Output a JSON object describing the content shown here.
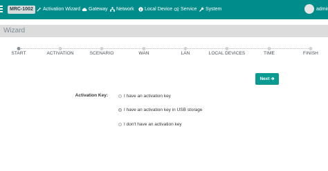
{
  "topbar": {
    "model": "MRC-1002",
    "nav": [
      {
        "label": "Activation Wizard",
        "icon": "wand-icon"
      },
      {
        "label": "Gateway",
        "icon": "cloud-icon"
      },
      {
        "label": "Network",
        "icon": "network-icon"
      },
      {
        "label": "Local Device",
        "icon": "info-icon"
      },
      {
        "label": "Service",
        "icon": "gears-icon"
      },
      {
        "label": "System",
        "icon": "wrench-icon"
      }
    ],
    "user": "admin"
  },
  "wizard": {
    "title": "Wizard",
    "steps": [
      {
        "label": "START",
        "active": true
      },
      {
        "label": "ACTIVATION",
        "active": false
      },
      {
        "label": "SCENARIO",
        "active": false
      },
      {
        "label": "WAN",
        "active": false
      },
      {
        "label": "LAN",
        "active": false
      },
      {
        "label": "LOCAL DEVICES",
        "active": false
      },
      {
        "label": "TIME",
        "active": false
      },
      {
        "label": "FINISH",
        "active": false
      }
    ],
    "next_label": "Next",
    "next_icon": "arrow-right-icon"
  },
  "form": {
    "activation_key_label": "Activation Key:",
    "options": [
      {
        "label": "I have an activation key",
        "selected": false
      },
      {
        "label": "I have an activation key in USB storage",
        "selected": true
      },
      {
        "label": "I don't have an activation key",
        "selected": false
      }
    ]
  },
  "colors": {
    "topbar": "#008c8a",
    "button": "#0a9a92",
    "header_bg": "#dcdcdc"
  }
}
